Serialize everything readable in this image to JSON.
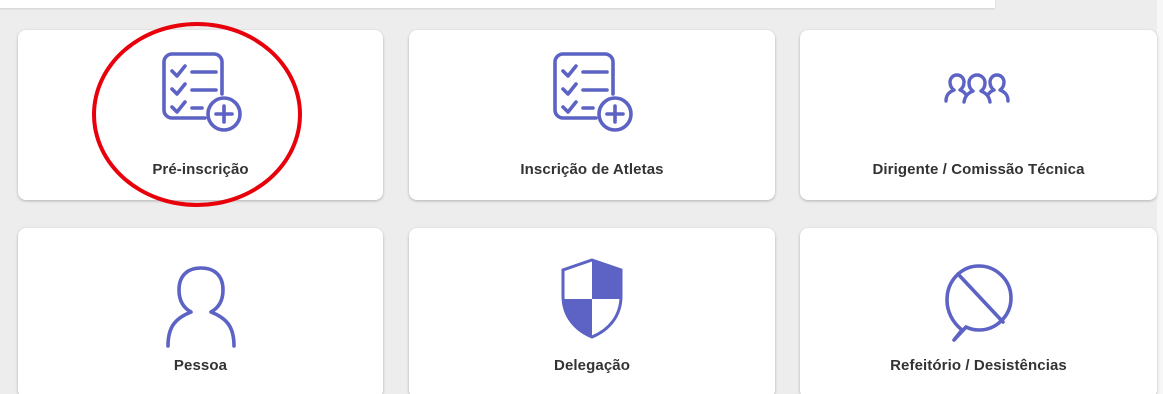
{
  "accent_color": "#5c63c4",
  "highlight_color": "#e8000b",
  "cards": [
    {
      "label": "Pré-inscrição",
      "icon": "checklist-add-icon",
      "highlighted": true
    },
    {
      "label": "Inscrição de Atletas",
      "icon": "checklist-add-icon",
      "highlighted": false
    },
    {
      "label": "Dirigente / Comissão Técnica",
      "icon": "group-icon",
      "highlighted": false
    },
    {
      "label": "Pessoa",
      "icon": "person-icon",
      "highlighted": false
    },
    {
      "label": "Delegação",
      "icon": "shield-icon",
      "highlighted": false
    },
    {
      "label": "Refeitório / Desistências",
      "icon": "chat-blocked-icon",
      "highlighted": false
    }
  ]
}
